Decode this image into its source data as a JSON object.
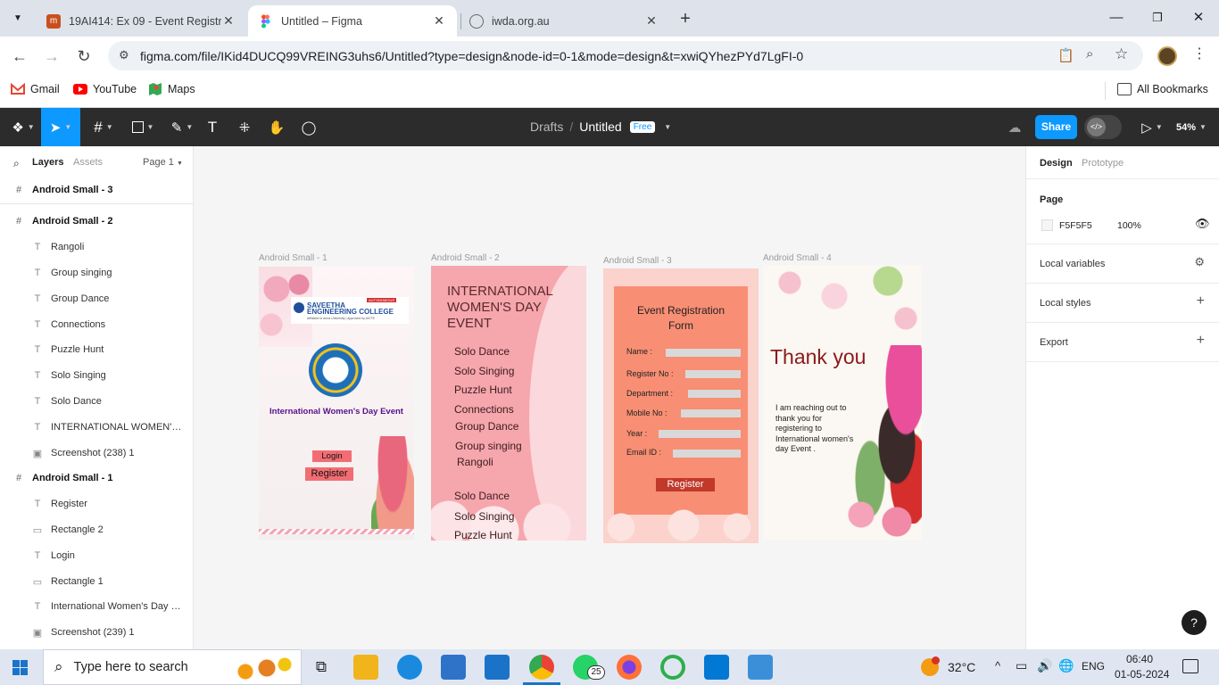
{
  "browser": {
    "tabs": [
      {
        "title": "19AI414: Ex 09 - Event Registrati",
        "active": false
      },
      {
        "title": "Untitled – Figma",
        "active": true
      },
      {
        "title": "iwda.org.au",
        "active": false
      }
    ],
    "url": "figma.com/file/IKid4DUCQ99VREING3uhs6/Untitled?type=design&node-id=0-1&mode=design&t=xwiQYhezPYd7LgFI-0",
    "bookmarks": [
      "Gmail",
      "YouTube",
      "Maps"
    ],
    "all_bookmarks": "All Bookmarks"
  },
  "figma": {
    "crumb_drafts": "Drafts",
    "crumb_sep": "/",
    "file_name": "Untitled",
    "plan_badge": "Free",
    "share": "Share",
    "zoom": "54%"
  },
  "left_panel": {
    "tabs": {
      "layers": "Layers",
      "assets": "Assets",
      "page": "Page 1"
    },
    "layers": [
      {
        "name": "Android Small - 3",
        "kind": "frame"
      },
      {
        "name": "Android Small - 2",
        "kind": "frame"
      },
      {
        "name": "Rangoli",
        "kind": "text"
      },
      {
        "name": "Group singing",
        "kind": "text"
      },
      {
        "name": "Group Dance",
        "kind": "text"
      },
      {
        "name": "Connections",
        "kind": "text"
      },
      {
        "name": "Puzzle Hunt",
        "kind": "text"
      },
      {
        "name": "Solo Singing",
        "kind": "text"
      },
      {
        "name": "Solo Dance",
        "kind": "text"
      },
      {
        "name": "INTERNATIONAL WOMEN'S D...",
        "kind": "text"
      },
      {
        "name": "Screenshot (238) 1",
        "kind": "image"
      },
      {
        "name": "Android Small - 1",
        "kind": "frame"
      },
      {
        "name": "Register",
        "kind": "text"
      },
      {
        "name": "Rectangle 2",
        "kind": "rect"
      },
      {
        "name": "Login",
        "kind": "text"
      },
      {
        "name": "Rectangle 1",
        "kind": "rect"
      },
      {
        "name": "International Women's Day Ev...",
        "kind": "text"
      },
      {
        "name": "Screenshot (239) 1",
        "kind": "image"
      }
    ]
  },
  "canvas": {
    "frame1": {
      "label": "Android Small - 1",
      "college": "SAVEETHA",
      "college2": "ENGINEERING COLLEGE",
      "autonomous": "AUTONOMOUS",
      "affiliation": "Affiliated to Anna University | Approved by AICTE",
      "event_title": "International Women's Day Event",
      "login": "Login",
      "register": "Register"
    },
    "frame2": {
      "label": "Android Small - 2",
      "heading": [
        "INTERNATIONAL",
        "WOMEN'S DAY",
        "EVENT"
      ],
      "events": [
        "Solo Dance",
        "Solo Singing",
        "Puzzle Hunt",
        "Connections",
        "Group Dance",
        "Group singing",
        "Rangoli"
      ]
    },
    "frame3": {
      "label": "Android Small - 3",
      "form_title": [
        "Event Registration",
        "Form"
      ],
      "fields": [
        "Name :",
        "Register No :",
        "Department :",
        "Mobile No :",
        "Year :",
        "Email ID :"
      ],
      "register": "Register"
    },
    "frame4": {
      "label": "Android Small - 4",
      "thank_you": "Thank you",
      "message": [
        "I am reaching out to",
        "thank you for",
        "registering to",
        "International women's",
        "day Event ."
      ]
    }
  },
  "right_panel": {
    "tabs": {
      "design": "Design",
      "prototype": "Prototype"
    },
    "page_label": "Page",
    "page_color": "F5F5F5",
    "page_opacity": "100%",
    "sections": [
      "Local variables",
      "Local styles",
      "Export"
    ]
  },
  "taskbar": {
    "search_placeholder": "Type here to search",
    "whatsapp_badge": "25",
    "temperature": "32°C",
    "language": "ENG",
    "time": "06:40",
    "date": "01-05-2024"
  },
  "colors": {
    "figma_blue": "#0d99ff",
    "figma_dark": "#2c2c2c",
    "canvas_bg": "#f5f5f5"
  }
}
